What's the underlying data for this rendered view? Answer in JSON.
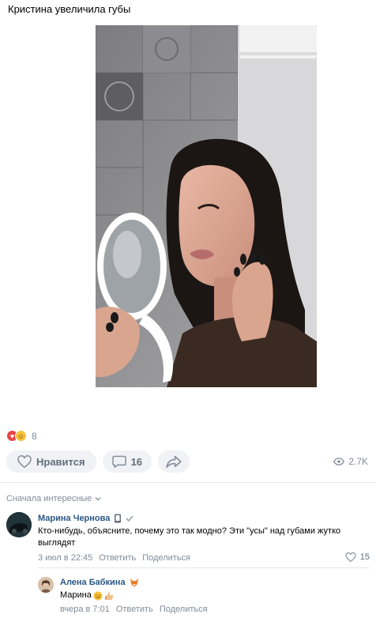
{
  "post": {
    "text": "Кристина увеличила губы"
  },
  "reactions": {
    "count": "8",
    "emojis": [
      "heart",
      "laughing-face"
    ]
  },
  "actions": {
    "like_label": "Нравится",
    "comments_count": "16",
    "views": "2.7K"
  },
  "comments_section": {
    "sort_label": "Сначала интересные"
  },
  "comments": [
    {
      "author": "Марина Чернова",
      "text": "Кто-нибудь, объясните, почему это так модно? Эти \"усы\" над губами жутко выглядят",
      "date": "3 июл в 22:45",
      "reply_label": "Ответить",
      "share_label": "Поделиться",
      "likes": "15"
    },
    {
      "author": "Алена Бабкина",
      "text": "Марина",
      "date": "вчера в 7:01",
      "reply_label": "Ответить",
      "share_label": "Поделиться"
    }
  ],
  "colors": {
    "link": "#2a5885",
    "muted": "#818c99",
    "pill_bg": "#f0f2f5"
  }
}
